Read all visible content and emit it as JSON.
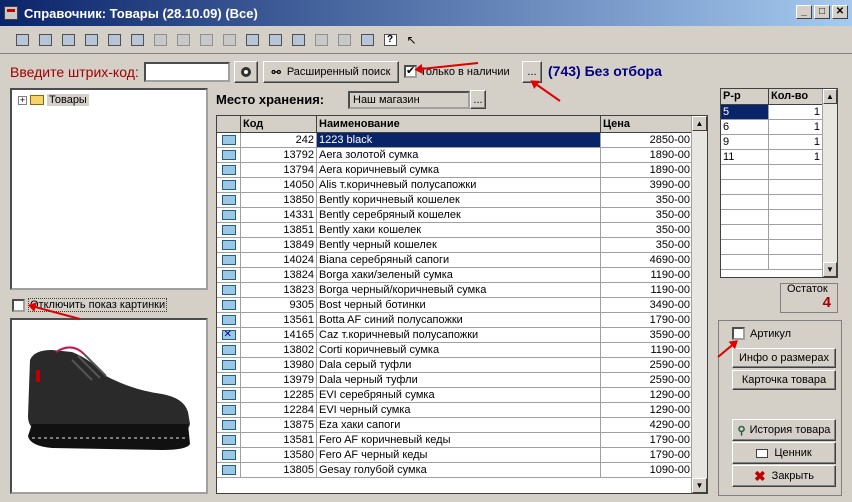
{
  "window": {
    "title": "Справочник: Товары (28.10.09) (Все)",
    "min_label": "_",
    "max_label": "□",
    "close_label": "✕"
  },
  "toolbar": {
    "icons": [
      "new-icon",
      "open-icon",
      "save-icon",
      "search-icon",
      "edit-icon",
      "delete-icon",
      "import-icon",
      "export-icon",
      "copy-icon",
      "move-icon",
      "filter-icon",
      "copy-doc-icon",
      "print-icon",
      "report-icon",
      "tree-icon",
      "print-preview-icon",
      "help-icon",
      "pointer-help-icon"
    ],
    "help_glyph": "?"
  },
  "barcode": {
    "label": "Введите штрих-код:",
    "value": "",
    "extended_search_label": "Расширенный поиск",
    "in_stock_label": "Только в наличии",
    "in_stock_checked": true,
    "ellipsis": "...",
    "count_text": "(743) Без отбора"
  },
  "tree": {
    "root_label": "Товары",
    "expand_glyph": "+"
  },
  "hide_picture": {
    "label": "Отключить показ картинки",
    "checked": false
  },
  "storage": {
    "label": "Место хранения:",
    "value": "Наш магазин",
    "ellipsis": "..."
  },
  "grid": {
    "columns": [
      "",
      "Код",
      "Наименование",
      "Цена"
    ],
    "rows": [
      {
        "code": "242",
        "name": "1223 black",
        "price": "2850-00",
        "selected": true,
        "marked": false
      },
      {
        "code": "13792",
        "name": "Aera золотой сумка",
        "price": "1890-00",
        "selected": false,
        "marked": false
      },
      {
        "code": "13794",
        "name": "Aera коричневый сумка",
        "price": "1890-00",
        "selected": false,
        "marked": false
      },
      {
        "code": "14050",
        "name": "Alis т.коричневый полусапожки",
        "price": "3990-00",
        "selected": false,
        "marked": false
      },
      {
        "code": "13850",
        "name": "Bently коричневый кошелек",
        "price": "350-00",
        "selected": false,
        "marked": false
      },
      {
        "code": "14331",
        "name": "Bently серебряный кошелек",
        "price": "350-00",
        "selected": false,
        "marked": false
      },
      {
        "code": "13851",
        "name": "Bently хаки кошелек",
        "price": "350-00",
        "selected": false,
        "marked": false
      },
      {
        "code": "13849",
        "name": "Bently черный кошелек",
        "price": "350-00",
        "selected": false,
        "marked": false
      },
      {
        "code": "14024",
        "name": "Biana серебряный сапоги",
        "price": "4690-00",
        "selected": false,
        "marked": false
      },
      {
        "code": "13824",
        "name": "Borga хаки/зеленый сумка",
        "price": "1190-00",
        "selected": false,
        "marked": false
      },
      {
        "code": "13823",
        "name": "Borga черный/коричневый сумка",
        "price": "1190-00",
        "selected": false,
        "marked": false
      },
      {
        "code": "9305",
        "name": "Bost черный ботинки",
        "price": "3490-00",
        "selected": false,
        "marked": false
      },
      {
        "code": "13561",
        "name": "Botta AF синий полусапожки",
        "price": "1790-00",
        "selected": false,
        "marked": false
      },
      {
        "code": "14165",
        "name": "Caz т.коричневый полусапожки",
        "price": "3590-00",
        "selected": false,
        "marked": true
      },
      {
        "code": "13802",
        "name": "Corti коричневый сумка",
        "price": "1190-00",
        "selected": false,
        "marked": false
      },
      {
        "code": "13980",
        "name": "Dala серый туфли",
        "price": "2590-00",
        "selected": false,
        "marked": false
      },
      {
        "code": "13979",
        "name": "Dala черный туфли",
        "price": "2590-00",
        "selected": false,
        "marked": false
      },
      {
        "code": "12285",
        "name": "EVI серебряный сумка",
        "price": "1290-00",
        "selected": false,
        "marked": false
      },
      {
        "code": "12284",
        "name": "EVI черный сумка",
        "price": "1290-00",
        "selected": false,
        "marked": false
      },
      {
        "code": "13875",
        "name": "Eza хаки сапоги",
        "price": "4290-00",
        "selected": false,
        "marked": false
      },
      {
        "code": "13581",
        "name": "Fero AF коричневый кеды",
        "price": "1790-00",
        "selected": false,
        "marked": false
      },
      {
        "code": "13580",
        "name": "Fero AF черный кеды",
        "price": "1790-00",
        "selected": false,
        "marked": false
      },
      {
        "code": "13805",
        "name": "Gesay голубой сумка",
        "price": "1090-00",
        "selected": false,
        "marked": false
      }
    ]
  },
  "sizes": {
    "columns": [
      "Р-р",
      "Кол-во"
    ],
    "rows": [
      {
        "size": "5",
        "qty": "1",
        "selected": true
      },
      {
        "size": "6",
        "qty": "1",
        "selected": false
      },
      {
        "size": "9",
        "qty": "1",
        "selected": false
      },
      {
        "size": "11",
        "qty": "1",
        "selected": false
      }
    ]
  },
  "remainder": {
    "label": "Остаток",
    "value": "4"
  },
  "right_panel": {
    "article_label": "Артикул",
    "article_checked": false,
    "size_info_label": "Инфо о размерах",
    "product_card_label": "Карточка товара",
    "history_label": "История товара",
    "price_tag_label": "Ценник",
    "close_label": "Закрыть"
  },
  "colors": {
    "accent_red": "#a00000",
    "count_blue": "#000080",
    "selection": "#0a246a",
    "annotation_arrow": "#e00000"
  }
}
